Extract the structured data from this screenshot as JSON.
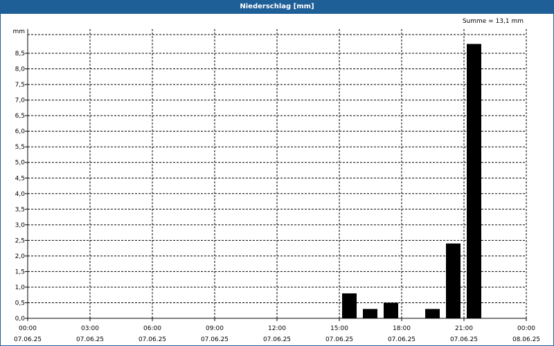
{
  "header": {
    "title": "Niederschlag [mm]"
  },
  "summary": {
    "text": "Summe = 13,1 mm"
  },
  "chart_data": {
    "type": "bar",
    "title": "Niederschlag [mm]",
    "ylabel": "mm",
    "xlabel": "",
    "ylim": [
      0,
      9.1
    ],
    "xlim": [
      "07.06.25 00:00",
      "08.06.25 00:00"
    ],
    "grid": true,
    "grid_style": "dashed",
    "bar_color": "#000000",
    "y_ticks": [
      "0,0",
      "0,5",
      "1,0",
      "1,5",
      "2,0",
      "2,5",
      "3,0",
      "3,5",
      "4,0",
      "4,5",
      "5,0",
      "5,5",
      "6,0",
      "6,5",
      "7,0",
      "7,5",
      "8,0",
      "8,5"
    ],
    "x_ticks": [
      {
        "time": "00:00",
        "date": "07.06.25"
      },
      {
        "time": "03:00",
        "date": "07.06.25"
      },
      {
        "time": "06:00",
        "date": "07.06.25"
      },
      {
        "time": "09:00",
        "date": "07.06.25"
      },
      {
        "time": "12:00",
        "date": "07.06.25"
      },
      {
        "time": "15:00",
        "date": "07.06.25"
      },
      {
        "time": "18:00",
        "date": "07.06.25"
      },
      {
        "time": "21:00",
        "date": "07.06.25"
      },
      {
        "time": "00:00",
        "date": "08.06.25"
      }
    ],
    "bars": [
      {
        "start": "15:00",
        "end": "16:00",
        "value": 0.8
      },
      {
        "start": "16:00",
        "end": "17:00",
        "value": 0.3
      },
      {
        "start": "17:00",
        "end": "18:00",
        "value": 0.5
      },
      {
        "start": "19:00",
        "end": "20:00",
        "value": 0.3
      },
      {
        "start": "20:00",
        "end": "21:00",
        "value": 2.4
      },
      {
        "start": "21:00",
        "end": "22:00",
        "value": 8.8
      }
    ]
  }
}
